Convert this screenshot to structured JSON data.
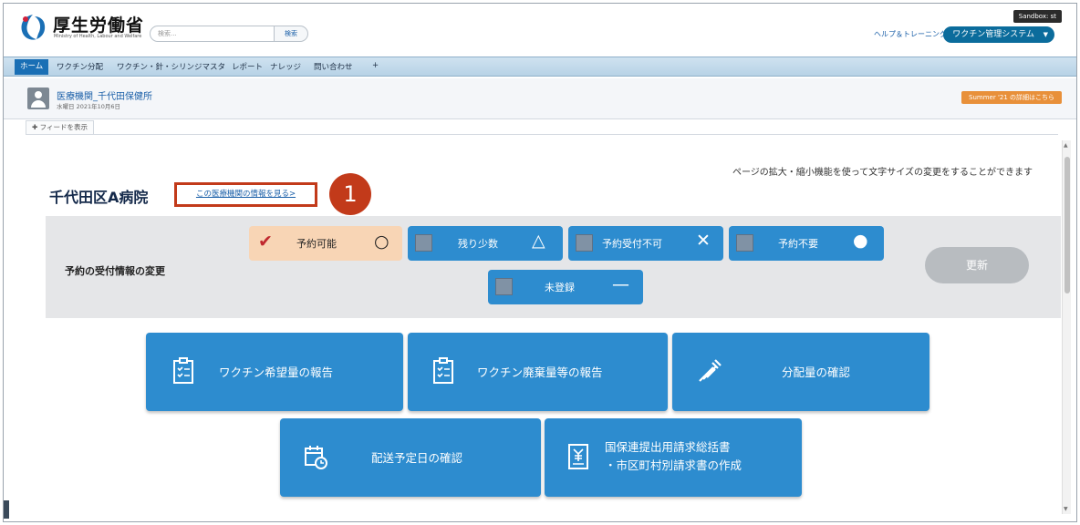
{
  "header": {
    "brand": "厚生労働省",
    "brand_sub": "Ministry of Health, Labour and Welfare",
    "search_placeholder": "検索...",
    "search_button": "検索",
    "sandbox": "Sandbox: st",
    "help": "ヘルプ＆トレーニング",
    "app_switcher": "ワクチン管理システム"
  },
  "nav": {
    "items": [
      "ホーム",
      "ワクチン分配",
      "ワクチン・針・シリンジマスタ",
      "レポート",
      "ナレッジ",
      "問い合わせ",
      "+"
    ]
  },
  "facility": {
    "name": "医療機関_千代田保健所",
    "date": "水曜日 2021年10月6日",
    "banner": "Summer '21 の詳細はこちら",
    "feed_toggle": "フィードを表示"
  },
  "main": {
    "zoom_note": "ページの拡大・縮小機能を使って文字サイズの変更をすることができます",
    "hospital_name": "千代田区A病院",
    "info_link": "この医療機関の情報を見る>",
    "marker": "1",
    "reservation_label": "予約の受付情報の変更",
    "statuses": [
      {
        "label": "予約可能",
        "symbol": "○",
        "selected": true
      },
      {
        "label": "残り少数",
        "symbol": "△",
        "selected": false
      },
      {
        "label": "予約受付不可",
        "symbol": "✕",
        "selected": false
      },
      {
        "label": "予約不要",
        "symbol": "●",
        "selected": false
      },
      {
        "label": "未登録",
        "symbol": "—",
        "selected": false
      }
    ],
    "update_button": "更新",
    "tiles": [
      {
        "label": "ワクチン希望量の報告",
        "icon": "clipboard-list-icon"
      },
      {
        "label": "ワクチン廃棄量等の報告",
        "icon": "clipboard-list-icon"
      },
      {
        "label": "分配量の確認",
        "icon": "syringe-icon"
      },
      {
        "label": "配送予定日の確認",
        "icon": "calendar-clock-icon"
      },
      {
        "line1": "国保連提出用請求総括書",
        "line2": "・市区町村別請求書の作成",
        "icon": "yen-document-icon"
      }
    ]
  },
  "colors": {
    "accent": "#2d8ccf",
    "highlight": "#c23a1a",
    "selected_status": "#f8d5b5",
    "nav_active": "#1a6fb5"
  }
}
